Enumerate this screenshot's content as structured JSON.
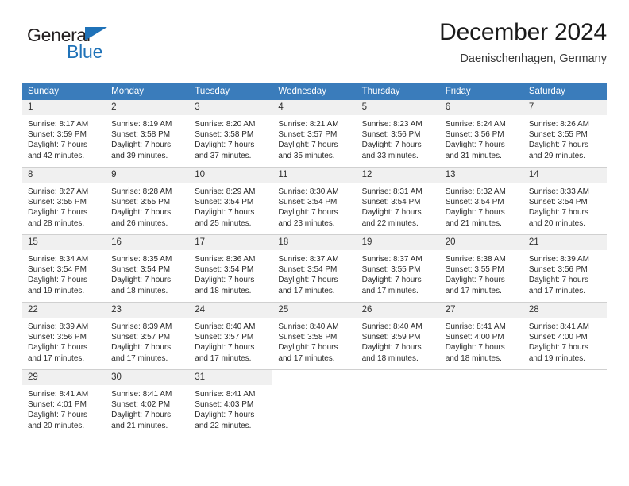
{
  "brand": {
    "name_part1": "General",
    "name_part2": "Blue",
    "color_dark": "#231f20",
    "color_blue": "#1f72b8"
  },
  "header": {
    "title": "December 2024",
    "subtitle": "Daenischenhagen, Germany"
  },
  "calendar": {
    "header_bg": "#3a7cbb",
    "header_text_color": "#ffffff",
    "daynum_bg": "#f0f0f0",
    "weekdays": [
      "Sunday",
      "Monday",
      "Tuesday",
      "Wednesday",
      "Thursday",
      "Friday",
      "Saturday"
    ],
    "weeks": [
      [
        {
          "day": "1",
          "sunrise": "Sunrise: 8:17 AM",
          "sunset": "Sunset: 3:59 PM",
          "daylight1": "Daylight: 7 hours",
          "daylight2": "and 42 minutes."
        },
        {
          "day": "2",
          "sunrise": "Sunrise: 8:19 AM",
          "sunset": "Sunset: 3:58 PM",
          "daylight1": "Daylight: 7 hours",
          "daylight2": "and 39 minutes."
        },
        {
          "day": "3",
          "sunrise": "Sunrise: 8:20 AM",
          "sunset": "Sunset: 3:58 PM",
          "daylight1": "Daylight: 7 hours",
          "daylight2": "and 37 minutes."
        },
        {
          "day": "4",
          "sunrise": "Sunrise: 8:21 AM",
          "sunset": "Sunset: 3:57 PM",
          "daylight1": "Daylight: 7 hours",
          "daylight2": "and 35 minutes."
        },
        {
          "day": "5",
          "sunrise": "Sunrise: 8:23 AM",
          "sunset": "Sunset: 3:56 PM",
          "daylight1": "Daylight: 7 hours",
          "daylight2": "and 33 minutes."
        },
        {
          "day": "6",
          "sunrise": "Sunrise: 8:24 AM",
          "sunset": "Sunset: 3:56 PM",
          "daylight1": "Daylight: 7 hours",
          "daylight2": "and 31 minutes."
        },
        {
          "day": "7",
          "sunrise": "Sunrise: 8:26 AM",
          "sunset": "Sunset: 3:55 PM",
          "daylight1": "Daylight: 7 hours",
          "daylight2": "and 29 minutes."
        }
      ],
      [
        {
          "day": "8",
          "sunrise": "Sunrise: 8:27 AM",
          "sunset": "Sunset: 3:55 PM",
          "daylight1": "Daylight: 7 hours",
          "daylight2": "and 28 minutes."
        },
        {
          "day": "9",
          "sunrise": "Sunrise: 8:28 AM",
          "sunset": "Sunset: 3:55 PM",
          "daylight1": "Daylight: 7 hours",
          "daylight2": "and 26 minutes."
        },
        {
          "day": "10",
          "sunrise": "Sunrise: 8:29 AM",
          "sunset": "Sunset: 3:54 PM",
          "daylight1": "Daylight: 7 hours",
          "daylight2": "and 25 minutes."
        },
        {
          "day": "11",
          "sunrise": "Sunrise: 8:30 AM",
          "sunset": "Sunset: 3:54 PM",
          "daylight1": "Daylight: 7 hours",
          "daylight2": "and 23 minutes."
        },
        {
          "day": "12",
          "sunrise": "Sunrise: 8:31 AM",
          "sunset": "Sunset: 3:54 PM",
          "daylight1": "Daylight: 7 hours",
          "daylight2": "and 22 minutes."
        },
        {
          "day": "13",
          "sunrise": "Sunrise: 8:32 AM",
          "sunset": "Sunset: 3:54 PM",
          "daylight1": "Daylight: 7 hours",
          "daylight2": "and 21 minutes."
        },
        {
          "day": "14",
          "sunrise": "Sunrise: 8:33 AM",
          "sunset": "Sunset: 3:54 PM",
          "daylight1": "Daylight: 7 hours",
          "daylight2": "and 20 minutes."
        }
      ],
      [
        {
          "day": "15",
          "sunrise": "Sunrise: 8:34 AM",
          "sunset": "Sunset: 3:54 PM",
          "daylight1": "Daylight: 7 hours",
          "daylight2": "and 19 minutes."
        },
        {
          "day": "16",
          "sunrise": "Sunrise: 8:35 AM",
          "sunset": "Sunset: 3:54 PM",
          "daylight1": "Daylight: 7 hours",
          "daylight2": "and 18 minutes."
        },
        {
          "day": "17",
          "sunrise": "Sunrise: 8:36 AM",
          "sunset": "Sunset: 3:54 PM",
          "daylight1": "Daylight: 7 hours",
          "daylight2": "and 18 minutes."
        },
        {
          "day": "18",
          "sunrise": "Sunrise: 8:37 AM",
          "sunset": "Sunset: 3:54 PM",
          "daylight1": "Daylight: 7 hours",
          "daylight2": "and 17 minutes."
        },
        {
          "day": "19",
          "sunrise": "Sunrise: 8:37 AM",
          "sunset": "Sunset: 3:55 PM",
          "daylight1": "Daylight: 7 hours",
          "daylight2": "and 17 minutes."
        },
        {
          "day": "20",
          "sunrise": "Sunrise: 8:38 AM",
          "sunset": "Sunset: 3:55 PM",
          "daylight1": "Daylight: 7 hours",
          "daylight2": "and 17 minutes."
        },
        {
          "day": "21",
          "sunrise": "Sunrise: 8:39 AM",
          "sunset": "Sunset: 3:56 PM",
          "daylight1": "Daylight: 7 hours",
          "daylight2": "and 17 minutes."
        }
      ],
      [
        {
          "day": "22",
          "sunrise": "Sunrise: 8:39 AM",
          "sunset": "Sunset: 3:56 PM",
          "daylight1": "Daylight: 7 hours",
          "daylight2": "and 17 minutes."
        },
        {
          "day": "23",
          "sunrise": "Sunrise: 8:39 AM",
          "sunset": "Sunset: 3:57 PM",
          "daylight1": "Daylight: 7 hours",
          "daylight2": "and 17 minutes."
        },
        {
          "day": "24",
          "sunrise": "Sunrise: 8:40 AM",
          "sunset": "Sunset: 3:57 PM",
          "daylight1": "Daylight: 7 hours",
          "daylight2": "and 17 minutes."
        },
        {
          "day": "25",
          "sunrise": "Sunrise: 8:40 AM",
          "sunset": "Sunset: 3:58 PM",
          "daylight1": "Daylight: 7 hours",
          "daylight2": "and 17 minutes."
        },
        {
          "day": "26",
          "sunrise": "Sunrise: 8:40 AM",
          "sunset": "Sunset: 3:59 PM",
          "daylight1": "Daylight: 7 hours",
          "daylight2": "and 18 minutes."
        },
        {
          "day": "27",
          "sunrise": "Sunrise: 8:41 AM",
          "sunset": "Sunset: 4:00 PM",
          "daylight1": "Daylight: 7 hours",
          "daylight2": "and 18 minutes."
        },
        {
          "day": "28",
          "sunrise": "Sunrise: 8:41 AM",
          "sunset": "Sunset: 4:00 PM",
          "daylight1": "Daylight: 7 hours",
          "daylight2": "and 19 minutes."
        }
      ],
      [
        {
          "day": "29",
          "sunrise": "Sunrise: 8:41 AM",
          "sunset": "Sunset: 4:01 PM",
          "daylight1": "Daylight: 7 hours",
          "daylight2": "and 20 minutes."
        },
        {
          "day": "30",
          "sunrise": "Sunrise: 8:41 AM",
          "sunset": "Sunset: 4:02 PM",
          "daylight1": "Daylight: 7 hours",
          "daylight2": "and 21 minutes."
        },
        {
          "day": "31",
          "sunrise": "Sunrise: 8:41 AM",
          "sunset": "Sunset: 4:03 PM",
          "daylight1": "Daylight: 7 hours",
          "daylight2": "and 22 minutes."
        },
        {
          "day": "",
          "sunrise": "",
          "sunset": "",
          "daylight1": "",
          "daylight2": ""
        },
        {
          "day": "",
          "sunrise": "",
          "sunset": "",
          "daylight1": "",
          "daylight2": ""
        },
        {
          "day": "",
          "sunrise": "",
          "sunset": "",
          "daylight1": "",
          "daylight2": ""
        },
        {
          "day": "",
          "sunrise": "",
          "sunset": "",
          "daylight1": "",
          "daylight2": ""
        }
      ]
    ]
  }
}
